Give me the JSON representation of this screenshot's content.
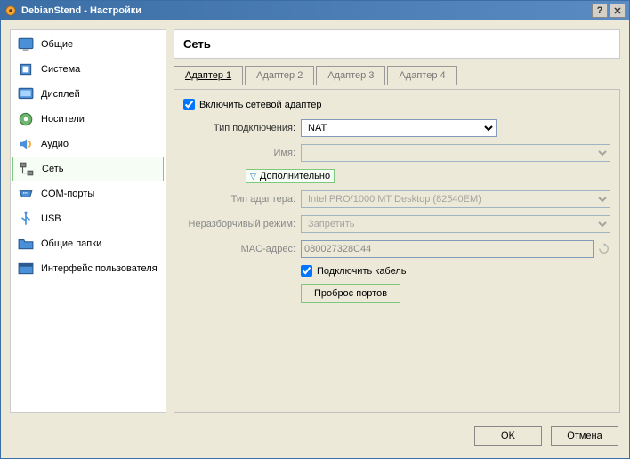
{
  "window": {
    "title": "DebianStend - Настройки"
  },
  "sidebar": {
    "items": [
      {
        "label": "Общие"
      },
      {
        "label": "Система"
      },
      {
        "label": "Дисплей"
      },
      {
        "label": "Носители"
      },
      {
        "label": "Аудио"
      },
      {
        "label": "Сеть"
      },
      {
        "label": "COM-порты"
      },
      {
        "label": "USB"
      },
      {
        "label": "Общие папки"
      },
      {
        "label": "Интерфейс пользователя"
      }
    ]
  },
  "main": {
    "title": "Сеть",
    "tabs": [
      {
        "label": "Адаптер 1"
      },
      {
        "label": "Адаптер 2"
      },
      {
        "label": "Адаптер 3"
      },
      {
        "label": "Адаптер 4"
      }
    ],
    "enable_label": "Включить сетевой адаптер",
    "attached_label": "Тип подключения:",
    "attached_value": "NAT",
    "name_label": "Имя:",
    "name_value": "",
    "advanced_label": "Дополнительно",
    "adapter_type_label": "Тип адаптера:",
    "adapter_type_value": "Intel PRO/1000 MT Desktop (82540EM)",
    "promisc_label": "Неразборчивый режим:",
    "promisc_value": "Запретить",
    "mac_label": "MAC-адрес:",
    "mac_value": "080027328C44",
    "cable_label": "Подключить кабель",
    "portfwd_label": "Проброс портов"
  },
  "footer": {
    "ok": "OK",
    "cancel": "Отмена"
  }
}
